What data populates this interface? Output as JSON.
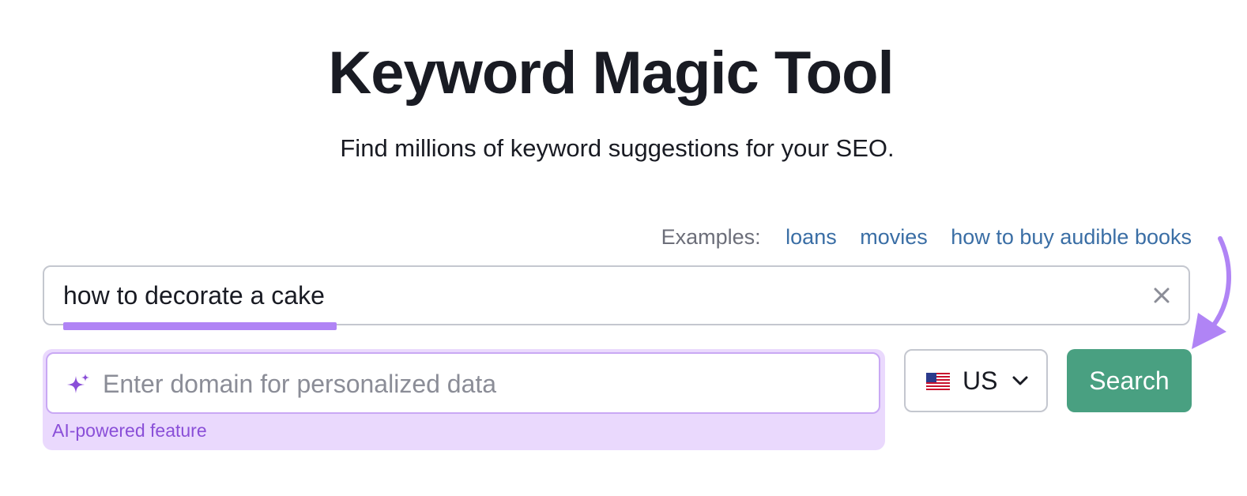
{
  "header": {
    "title": "Keyword Magic Tool",
    "subtitle": "Find millions of keyword suggestions for your SEO."
  },
  "examples": {
    "label": "Examples:",
    "links": [
      "loans",
      "movies",
      "how to buy audible books"
    ]
  },
  "keyword_search": {
    "value": "how to decorate a cake",
    "clear_icon": "close-icon"
  },
  "domain_search": {
    "placeholder": "Enter domain for personalized data",
    "value": "",
    "icon": "sparkle-icon",
    "note": "AI-powered feature"
  },
  "country_select": {
    "selected": "US",
    "flag_icon": "us-flag-icon",
    "chevron_icon": "chevron-down-icon"
  },
  "search_button": {
    "label": "Search"
  },
  "colors": {
    "accent_purple": "#b084f5",
    "ai_background": "#ead9fd",
    "ai_text": "#8a4fd8",
    "search_button": "#49a081",
    "link": "#3a6ea5"
  }
}
